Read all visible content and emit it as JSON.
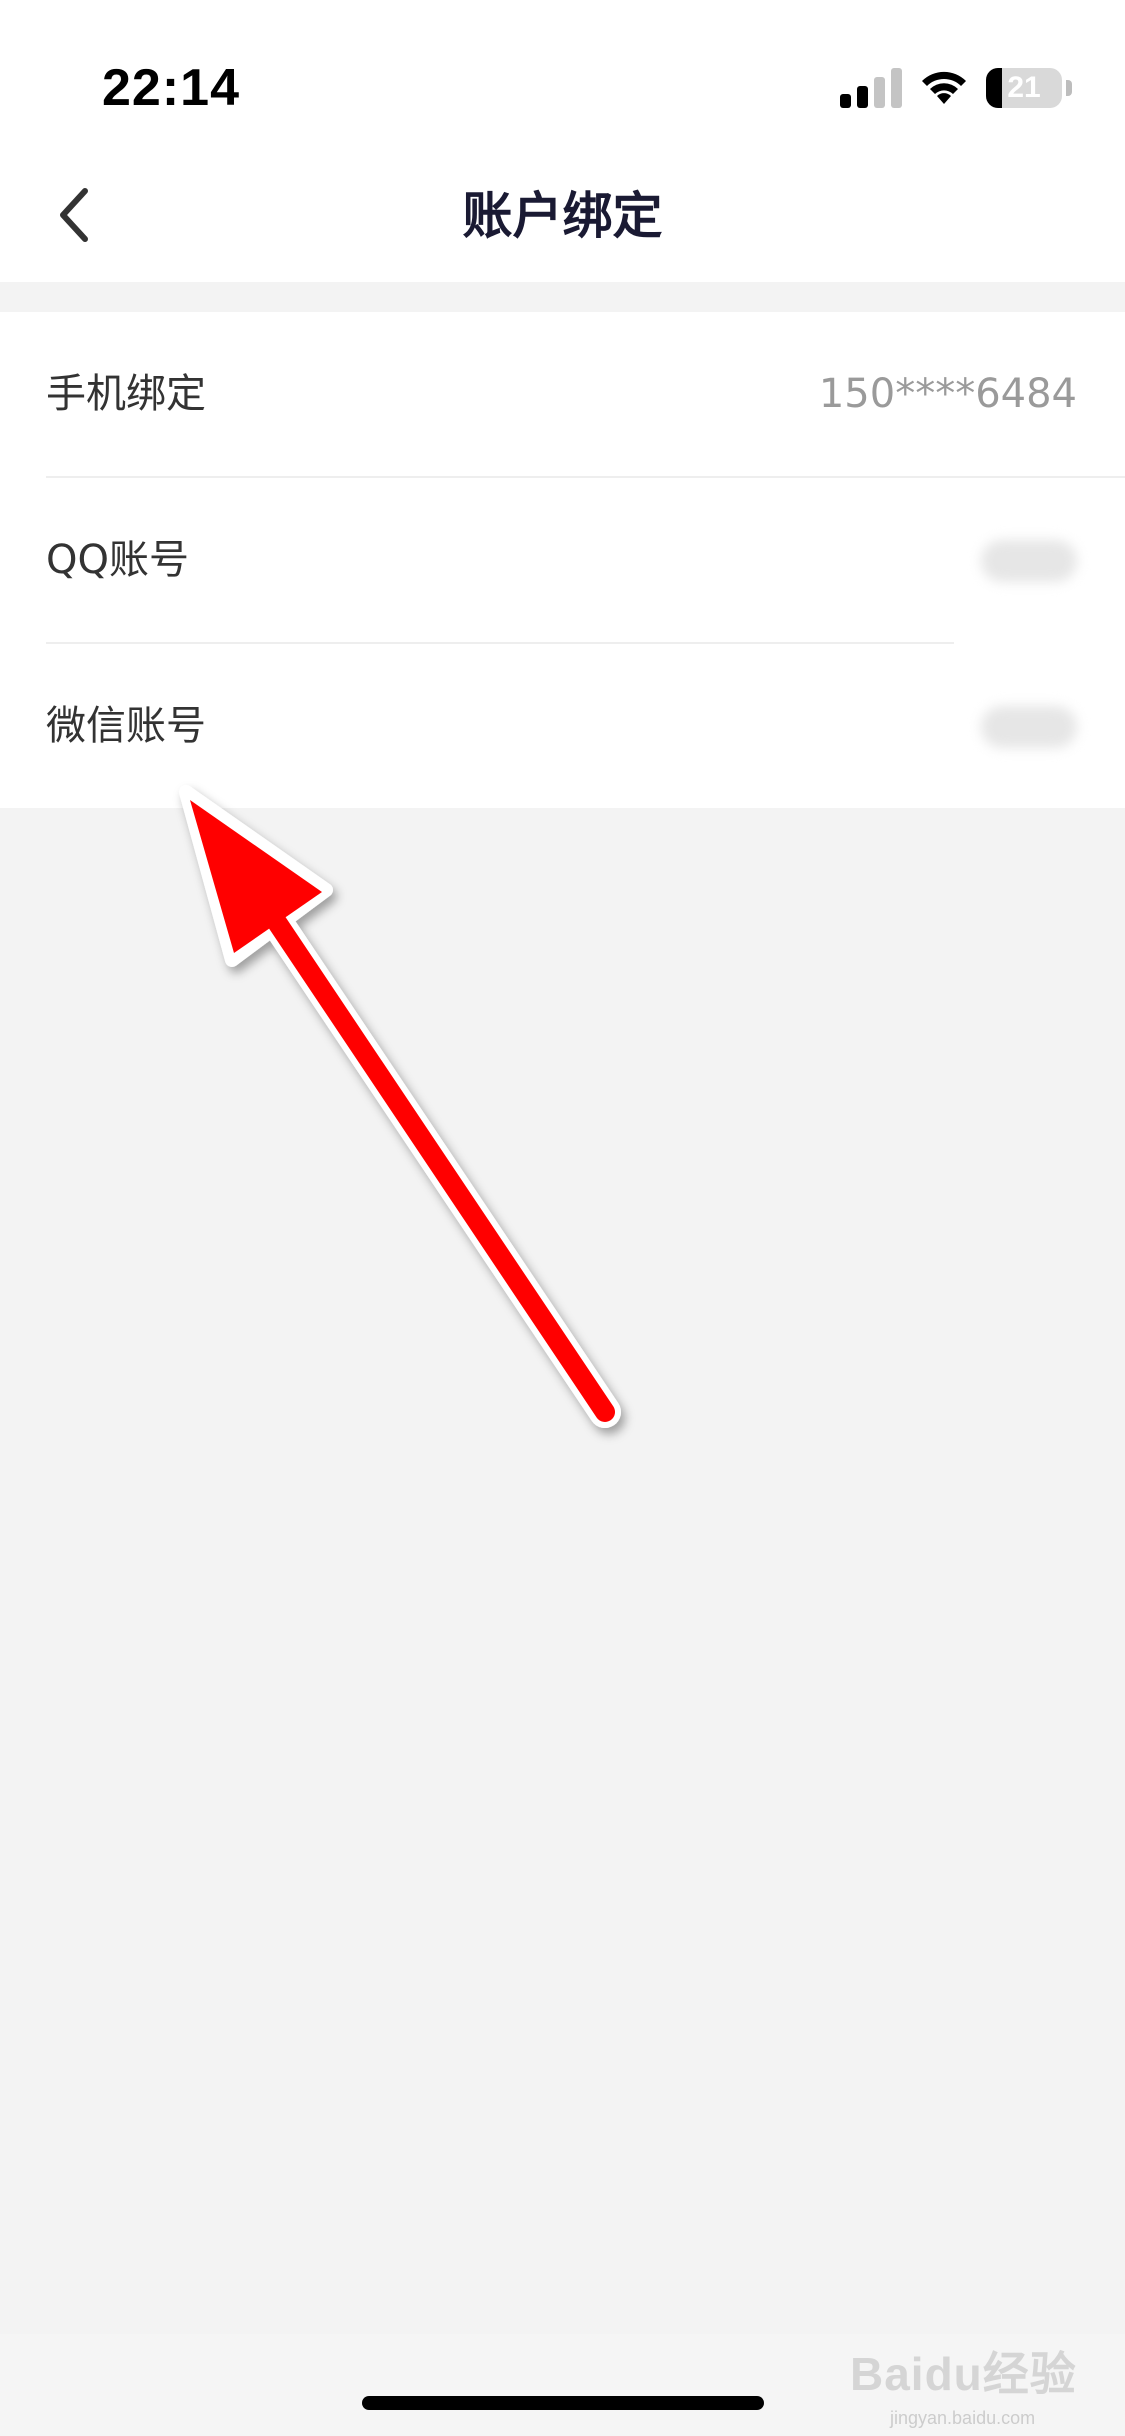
{
  "status_bar": {
    "time": "22:14",
    "battery_level": "21",
    "battery_fraction": 0.21,
    "icons": [
      "cellular-signal-icon",
      "wifi-icon",
      "battery-icon"
    ]
  },
  "nav": {
    "title": "账户绑定",
    "back_icon": "chevron-left-icon"
  },
  "rows": [
    {
      "label": "手机绑定",
      "value": "150****6484"
    },
    {
      "label": "QQ账号",
      "value": ""
    },
    {
      "label": "微信账号",
      "value": ""
    }
  ],
  "watermark": {
    "brand": "Baidu经验",
    "url": "jingyan.baidu.com"
  },
  "colors": {
    "arrow": "#ff0000",
    "title": "#1a1a33",
    "label": "#333333",
    "value": "#9a9a9a",
    "background": "#f3f3f3"
  }
}
